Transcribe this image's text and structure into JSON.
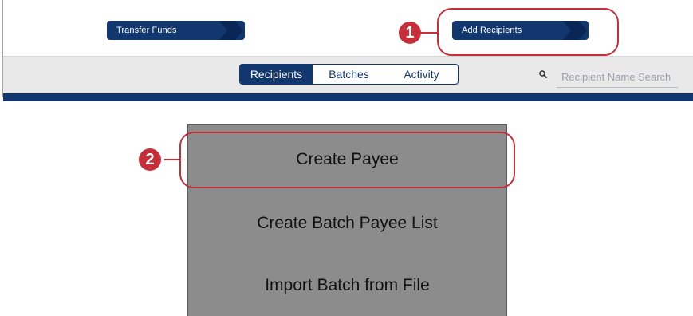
{
  "top_actions": {
    "transfer_funds_label": "Transfer Funds",
    "add_recipients_label": "Add Recipients"
  },
  "tabs": [
    {
      "label": "Recipients",
      "active": true
    },
    {
      "label": "Batches",
      "active": false
    },
    {
      "label": "Activity",
      "active": false
    }
  ],
  "search": {
    "placeholder": "Recipient Name Search",
    "icon": "search-icon"
  },
  "dropdown_menu": {
    "items": [
      {
        "label": "Create Payee"
      },
      {
        "label": "Create Batch Payee List"
      },
      {
        "label": "Import Batch from File"
      }
    ]
  },
  "callouts": [
    {
      "number": "1"
    },
    {
      "number": "2"
    }
  ],
  "colors": {
    "brand_navy": "#12366e",
    "callout_red": "#c62f3a",
    "toolbar_gray": "#e9e9ea",
    "menu_gray": "#8c8c8c"
  }
}
